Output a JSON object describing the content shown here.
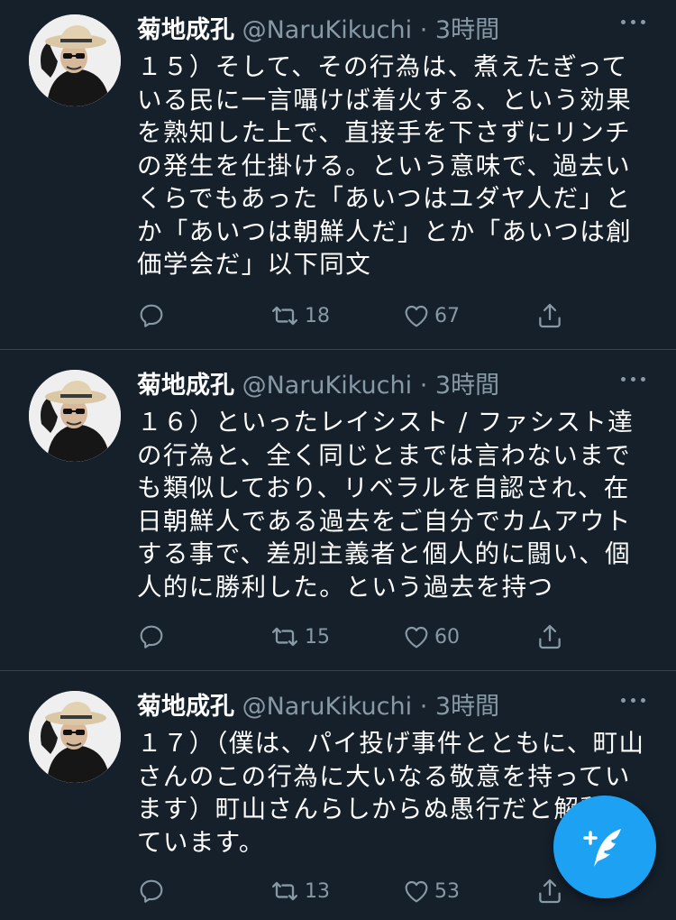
{
  "tweets": [
    {
      "author_name": "菊地成孔",
      "handle": "@NaruKikuchi",
      "separator": "·",
      "time": "3時間",
      "text": "１５）そして、その行為は、煮えたぎっている民に一言囁けば着火する、という効果を熟知した上で、直接手を下さずにリンチの発生を仕掛ける。という意味で、過去いくらでもあった「あいつはユダヤ人だ」とか「あいつは朝鮮人だ」とか「あいつは創価学会だ」以下同文",
      "retweets": "18",
      "likes": "67"
    },
    {
      "author_name": "菊地成孔",
      "handle": "@NaruKikuchi",
      "separator": "·",
      "time": "3時間",
      "text": "１６）といったレイシスト / ファシスト達の行為と、全く同じとまでは言わないまでも類似しており、リベラルを自認され、在日朝鮮人である過去をご自分でカムアウトする事で、差別主義者と個人的に闘い、個人的に勝利した。という過去を持つ",
      "retweets": "15",
      "likes": "60"
    },
    {
      "author_name": "菊地成孔",
      "handle": "@NaruKikuchi",
      "separator": "·",
      "time": "3時間",
      "text": "１７）（僕は、パイ投げ事件とともに、町山さんのこの行為に大いなる敬意を持っています）町山さんらしからぬ愚行だと解釈しています。",
      "retweets": "13",
      "likes": "53"
    }
  ],
  "icons": {
    "reply": "reply-icon",
    "retweet": "retweet-icon",
    "like": "heart-icon",
    "share": "share-icon",
    "compose": "compose-tweet-icon",
    "more": "more-dots-icon"
  },
  "colors": {
    "background": "#15202b",
    "divider": "#38444d",
    "secondary_text": "#8899a6",
    "accent": "#1da1f2"
  }
}
